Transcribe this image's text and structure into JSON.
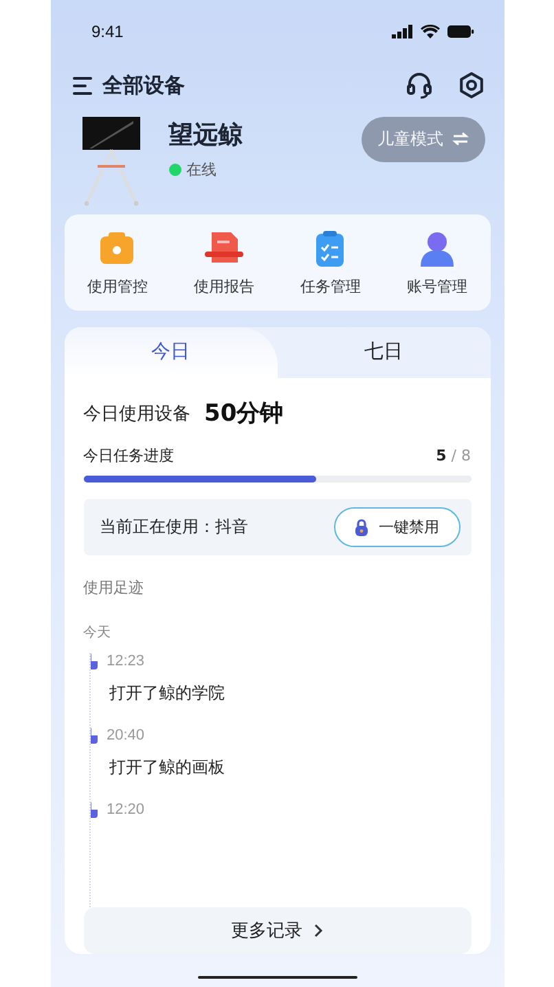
{
  "status_bar": {
    "time": "9:41"
  },
  "header": {
    "title": "全部设备"
  },
  "device": {
    "name": "望远鲸",
    "status": "在线",
    "online": true,
    "mode_button": "儿童模式"
  },
  "quick_actions": [
    {
      "label": "使用管控",
      "kind": "control"
    },
    {
      "label": "使用报告",
      "kind": "report"
    },
    {
      "label": "任务管理",
      "kind": "tasks"
    },
    {
      "label": "账号管理",
      "kind": "account"
    }
  ],
  "tabs": [
    {
      "label": "今日",
      "selected": true
    },
    {
      "label": "七日",
      "selected": false
    }
  ],
  "usage": {
    "label": "今日使用设备",
    "value": "50分钟"
  },
  "progress": {
    "label": "今日任务进度",
    "done": "5",
    "total": "/ 8",
    "level": 0.6
  },
  "current": {
    "text": "当前正在使用：抖音",
    "button": "一键禁用"
  },
  "footprint": {
    "title": "使用足迹",
    "day": "今天",
    "entries": [
      {
        "time": "12:23",
        "action": "打开了鲸的学院"
      },
      {
        "time": "20:40",
        "action": "打开了鲸的画板"
      },
      {
        "time": "12:20"
      }
    ]
  },
  "more_button": "更多记录"
}
